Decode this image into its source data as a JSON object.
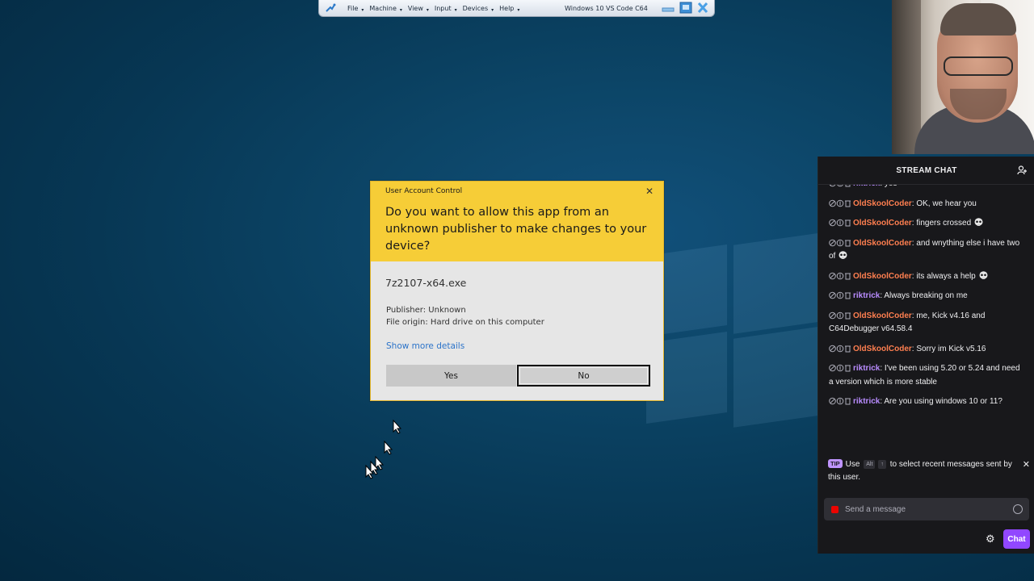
{
  "vm_toolbar": {
    "menus": [
      "File",
      "Machine",
      "View",
      "Input",
      "Devices",
      "Help"
    ],
    "title": "Windows 10 VS Code C64"
  },
  "uac": {
    "caption": "User Account Control",
    "question": "Do you want to allow this app from an unknown publisher to make changes to your device?",
    "program": "7z2107-x64.exe",
    "publisher": "Publisher: Unknown",
    "origin": "File origin: Hard drive on this computer",
    "more_details": "Show more details",
    "yes_label": "Yes",
    "no_label": "No",
    "colors": {
      "header": "#f6cd37",
      "body": "#e6e6e6",
      "link": "#2b73c9"
    }
  },
  "chat": {
    "header": "STREAM CHAT",
    "messages": [
      {
        "user": "riktrick",
        "color": "purple",
        "text": ": yes",
        "skull": false
      },
      {
        "user": "OldSkoolCoder",
        "color": "orange",
        "text": ": OK, we hear you",
        "skull": false
      },
      {
        "user": "OldSkoolCoder",
        "color": "orange",
        "text": ": fingers crossed",
        "skull": true
      },
      {
        "user": "OldSkoolCoder",
        "color": "orange",
        "text": ": and wnything else i have two of",
        "skull": true
      },
      {
        "user": "OldSkoolCoder",
        "color": "orange",
        "text": ": its always a help",
        "skull": true
      },
      {
        "user": "riktrick",
        "color": "purple",
        "text": ": Always breaking on me",
        "skull": false
      },
      {
        "user": "OldSkoolCoder",
        "color": "orange",
        "text": ": me, Kick v4.16 and C64Debugger v64.58.4",
        "skull": false
      },
      {
        "user": "OldSkoolCoder",
        "color": "orange",
        "text": ": Sorry im Kick v5.16",
        "skull": false
      },
      {
        "user": "riktrick",
        "color": "purple",
        "text": ": I've been using 5.20 or 5.24 and need a version which is more stable",
        "skull": false
      },
      {
        "user": "riktrick",
        "color": "purple",
        "text": ": Are you using windows 10 or 11?",
        "skull": false
      }
    ],
    "tip": {
      "badge": "TIP",
      "before": "Use",
      "key1": "Alt",
      "key2": "↑",
      "after": "to select recent messages sent by this user."
    },
    "input_placeholder": "Send a message",
    "send_label": "Chat",
    "colors": {
      "orange": "#ff7f50",
      "purple": "#b98cff",
      "accent": "#9147ff"
    }
  }
}
